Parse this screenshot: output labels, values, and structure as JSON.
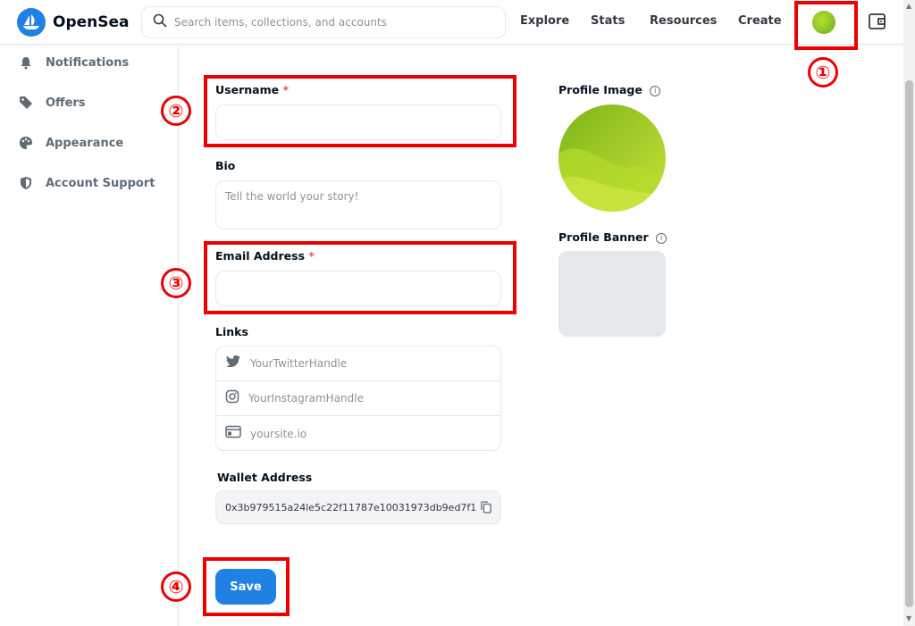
{
  "header": {
    "brand": "OpenSea",
    "search_placeholder": "Search items, collections, and accounts",
    "nav": [
      "Explore",
      "Stats",
      "Resources",
      "Create"
    ]
  },
  "sidebar": {
    "items": [
      {
        "label": "Notifications",
        "icon": "bell-icon"
      },
      {
        "label": "Offers",
        "icon": "tag-icon"
      },
      {
        "label": "Appearance",
        "icon": "palette-icon"
      },
      {
        "label": "Account Support",
        "icon": "shield-icon"
      }
    ]
  },
  "form": {
    "username_label": "Username",
    "username_value": "",
    "required_mark": "*",
    "bio_label": "Bio",
    "bio_placeholder": "Tell the world your story!",
    "email_label": "Email Address",
    "email_value": "",
    "links_label": "Links",
    "links": [
      {
        "placeholder": "YourTwitterHandle",
        "icon": "twitter-icon"
      },
      {
        "placeholder": "YourInstagramHandle",
        "icon": "instagram-icon"
      },
      {
        "placeholder": "yoursite.io",
        "icon": "website-icon"
      }
    ],
    "wallet_label": "Wallet Address",
    "wallet_value": "0x3b979515a24le5c22f11787e10031973db9ed7f1",
    "save_label": "Save"
  },
  "right": {
    "profile_image_label": "Profile Image",
    "profile_banner_label": "Profile Banner",
    "info_glyph": "i"
  },
  "annotations": [
    "①",
    "②",
    "③",
    "④"
  ],
  "colors": {
    "accent": "#2081e2",
    "annotation": "#ee0000",
    "required": "#eb5757",
    "avatar": "#8cc42a"
  }
}
